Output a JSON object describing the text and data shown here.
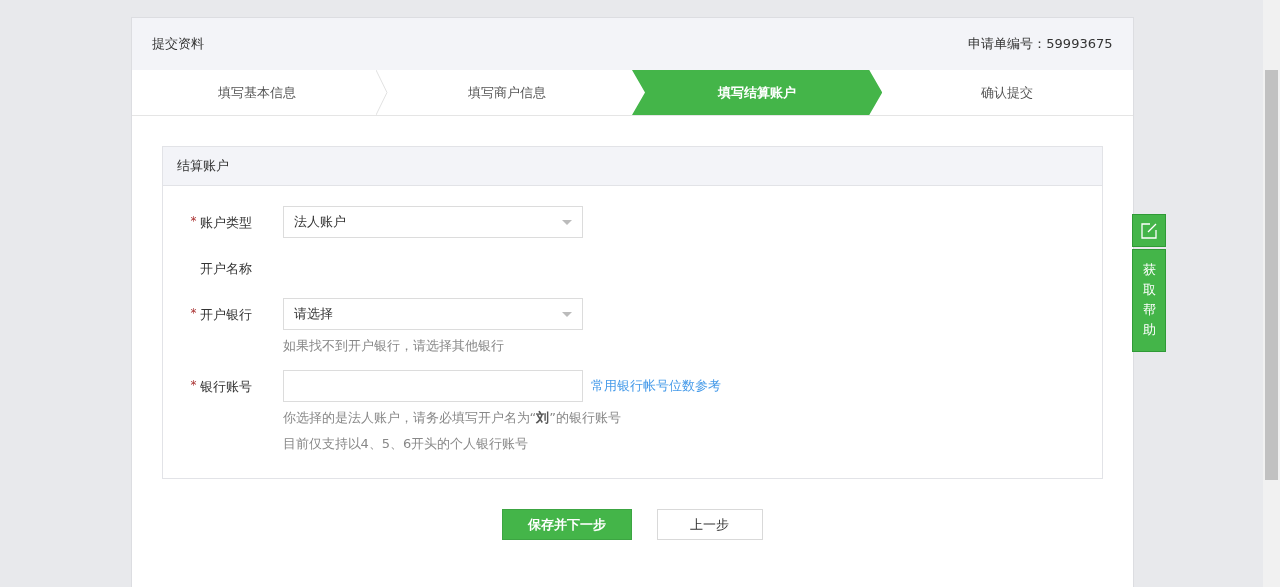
{
  "header": {
    "title": "提交资料",
    "application_label": "申请单编号：",
    "application_number": "59993675"
  },
  "steps": [
    {
      "label": "填写基本信息",
      "selected": false
    },
    {
      "label": "填写商户信息",
      "selected": false
    },
    {
      "label": "填写结算账户",
      "selected": true
    },
    {
      "label": "确认提交",
      "selected": false
    }
  ],
  "section": {
    "title": "结算账户",
    "fields": [
      {
        "kind": "select",
        "label": "账户类型",
        "required_mark": "*",
        "value": "法人账户"
      },
      {
        "kind": "static",
        "label": "开户名称"
      },
      {
        "kind": "select",
        "label": "开户银行",
        "required_mark": "*",
        "value": "请选择",
        "hints": [
          "如果找不到开户银行，请选择其他银行"
        ]
      },
      {
        "kind": "input",
        "label": "银行账号",
        "required_mark": "*",
        "link": "常用银行帐号位数参考",
        "hints": [
          "你选择的是法人账户，请务必填写开户名为“**刘**”的银行账号",
          "目前仅支持以4、5、6开头的个人银行账号"
        ]
      }
    ]
  },
  "buttons": [
    {
      "label": "保存并下一步",
      "kind": "primary"
    },
    {
      "label": "上一步",
      "kind": "secondary"
    }
  ],
  "help": {
    "label": "获取帮助"
  }
}
